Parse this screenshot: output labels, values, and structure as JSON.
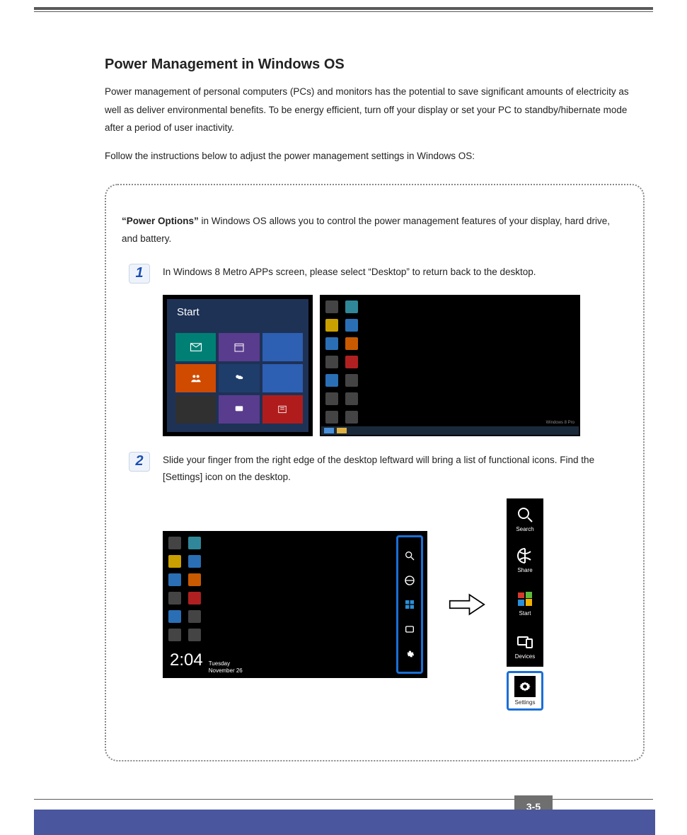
{
  "heading": "Power Management in Windows OS",
  "intro_p1": "Power management of personal computers (PCs) and monitors has the potential to save significant amounts of electricity as well as deliver environmental benefits. To be energy efficient, turn off your display or set your PC to standby/hibernate mode after a period of user inactivity.",
  "intro_p2": "Follow the instructions below to adjust the power management settings in Windows OS:",
  "box_lead_bold": "“Power Options”",
  "box_lead_rest": " in Windows OS allows you to control the power management features of your display, hard drive, and battery.",
  "step1_num": "1",
  "step1_text": "In Windows 8 Metro APPs screen, please select “Desktop” to return back to the desktop.",
  "step2_num": "2",
  "step2_text": "Slide your finger from the right edge of the desktop leftward will bring a list of functional icons. Find the [Settings] icon on the desktop.",
  "start_label": "Start",
  "win_tag": "Windows 8 Pro",
  "clock_time": "2:04",
  "clock_day": "Tuesday",
  "clock_date": "November 26",
  "charms": {
    "search": "Search",
    "share": "Share",
    "start": "Start",
    "devices": "Devices",
    "settings": "Settings"
  },
  "page_number": "3-5"
}
